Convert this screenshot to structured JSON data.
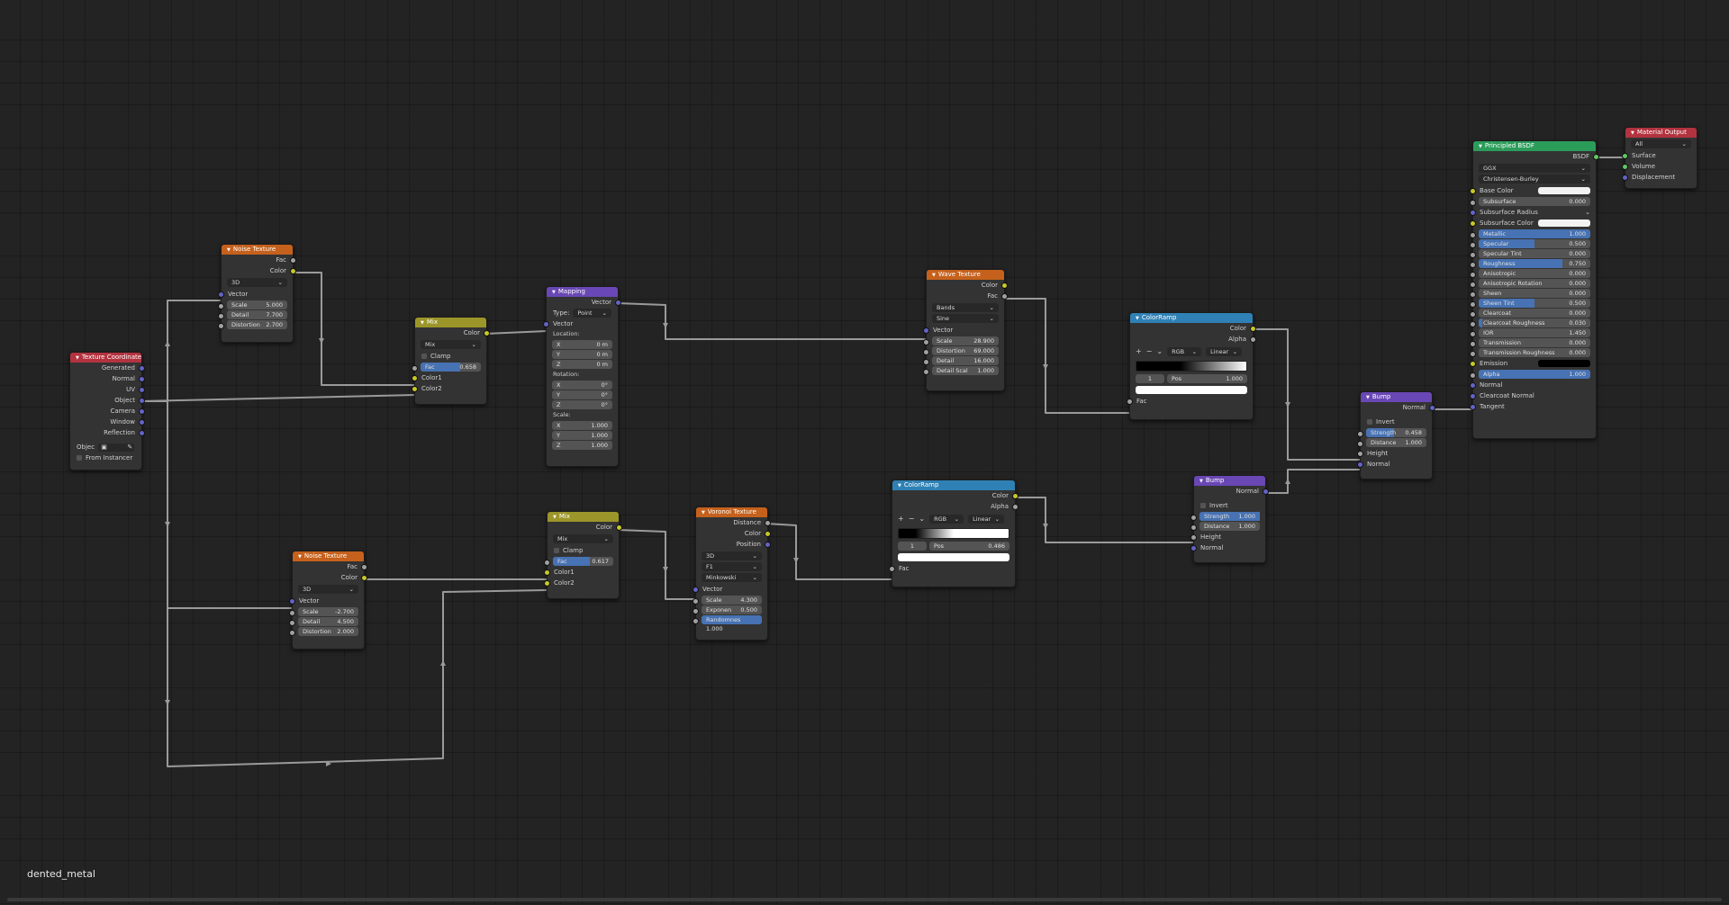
{
  "editor": {
    "frame_label": "dented_metal"
  },
  "texcoord": {
    "title": "Texture Coordinate",
    "outputs": [
      "Generated",
      "Normal",
      "UV",
      "Object",
      "Camera",
      "Window",
      "Reflection"
    ],
    "object_label": "Objec",
    "from_instancer": "From Instancer"
  },
  "noise1": {
    "title": "Noise Texture",
    "out_fac": "Fac",
    "out_color": "Color",
    "dim": "3D",
    "vector": "Vector",
    "fields": [
      {
        "label": "Scale",
        "value": "5.000"
      },
      {
        "label": "Detail",
        "value": "7.700"
      },
      {
        "label": "Distortion",
        "value": "2.700"
      }
    ]
  },
  "noise2": {
    "title": "Noise Texture",
    "out_fac": "Fac",
    "out_color": "Color",
    "dim": "3D",
    "vector": "Vector",
    "fields": [
      {
        "label": "Scale",
        "value": "-2.700"
      },
      {
        "label": "Detail",
        "value": "4.500"
      },
      {
        "label": "Distortion",
        "value": "2.000"
      }
    ]
  },
  "mix1": {
    "title": "Mix",
    "out": "Color",
    "mode": "Mix",
    "clamp": "Clamp",
    "fac_label": "Fac",
    "fac": "0.658",
    "fac_value": 0.658,
    "color1": "Color1",
    "color2": "Color2"
  },
  "mix2": {
    "title": "Mix",
    "out": "Color",
    "mode": "Mix",
    "clamp": "Clamp",
    "fac_label": "Fac",
    "fac": "0.617",
    "fac_value": 0.617,
    "color1": "Color1",
    "color2": "Color2"
  },
  "mapping": {
    "title": "Mapping",
    "out": "Vector",
    "type_label": "Type:",
    "type": "Point",
    "vector": "Vector",
    "location_label": "Location:",
    "location": [
      {
        "a": "X",
        "v": "0 m"
      },
      {
        "a": "Y",
        "v": "0 m"
      },
      {
        "a": "Z",
        "v": "0 m"
      }
    ],
    "rotation_label": "Rotation:",
    "rotation": [
      {
        "a": "X",
        "v": "0°"
      },
      {
        "a": "Y",
        "v": "0°"
      },
      {
        "a": "Z",
        "v": "0°"
      }
    ],
    "scale_label": "Scale:",
    "scale": [
      {
        "a": "X",
        "v": "1.000"
      },
      {
        "a": "Y",
        "v": "1.000"
      },
      {
        "a": "Z",
        "v": "1.000"
      }
    ]
  },
  "voronoi": {
    "title": "Voronoi Texture",
    "outputs": [
      "Distance",
      "Color",
      "Position"
    ],
    "dim": "3D",
    "feature": "F1",
    "metric": "Minkowski",
    "vector": "Vector",
    "fields": [
      {
        "label": "Scale",
        "value": "4.300"
      },
      {
        "label": "Exponen",
        "value": "0.500"
      }
    ],
    "randomness": "Randomnes 1.000",
    "randomness_value": 1.0
  },
  "wave": {
    "title": "Wave Texture",
    "out_color": "Color",
    "out_fac": "Fac",
    "type": "Bands",
    "profile": "Sine",
    "vector": "Vector",
    "fields": [
      {
        "label": "Scale",
        "value": "28.900"
      },
      {
        "label": "Distortion",
        "value": "69.000"
      },
      {
        "label": "Detail",
        "value": "16.000"
      },
      {
        "label": "Detail Scal",
        "value": "1.000"
      }
    ]
  },
  "ramp1": {
    "title": "ColorRamp",
    "out_color": "Color",
    "out_alpha": "Alpha",
    "mode": "RGB",
    "interp": "Linear",
    "index": "1",
    "pos_label": "Pos",
    "pos": "1.000",
    "fac": "Fac"
  },
  "ramp2": {
    "title": "ColorRamp",
    "out_color": "Color",
    "out_alpha": "Alpha",
    "mode": "RGB",
    "interp": "Linear",
    "index": "1",
    "pos_label": "Pos",
    "pos": "0.486",
    "fac": "Fac"
  },
  "bump1": {
    "title": "Bump",
    "out": "Normal",
    "invert": "Invert",
    "strength_label": "Strength",
    "strength": "0.458",
    "strength_value": 0.458,
    "distance_label": "Distance",
    "distance": "1.000",
    "height": "Height",
    "normal": "Normal"
  },
  "bump2": {
    "title": "Bump",
    "out": "Normal",
    "invert": "Invert",
    "strength_label": "Strength",
    "strength": "1.000",
    "strength_value": 1.0,
    "distance_label": "Distance",
    "distance": "1.000",
    "height": "Height",
    "normal": "Normal"
  },
  "bsdf": {
    "title": "Principled BSDF",
    "out": "BSDF",
    "distribution": "GGX",
    "subsurface_method": "Christensen-Burley",
    "base_color": "Base Color",
    "subsurface_color": "Subsurface Color",
    "subsurface_radius": "Subsurface Radius",
    "rows": [
      {
        "label": "Subsurface",
        "value": "0.000",
        "fill": 0
      },
      {
        "label": "Metallic",
        "value": "1.000",
        "fill": 1
      },
      {
        "label": "Specular",
        "value": "0.500",
        "fill": 0.5
      },
      {
        "label": "Specular Tint",
        "value": "0.000",
        "fill": 0
      },
      {
        "label": "Roughness",
        "value": "0.750",
        "fill": 0.75
      },
      {
        "label": "Anisotropic",
        "value": "0.000",
        "fill": 0
      },
      {
        "label": "Anisotropic Rotation",
        "value": "0.000",
        "fill": 0
      },
      {
        "label": "Sheen",
        "value": "0.000",
        "fill": 0
      },
      {
        "label": "Sheen Tint",
        "value": "0.500",
        "fill": 0.5
      },
      {
        "label": "Clearcoat",
        "value": "0.000",
        "fill": 0
      },
      {
        "label": "Clearcoat Roughness",
        "value": "0.030",
        "fill": 0.03
      },
      {
        "label": "IOR",
        "value": "1.450",
        "fill": 0
      },
      {
        "label": "Transmission",
        "value": "0.000",
        "fill": 0
      },
      {
        "label": "Transmission Roughness",
        "value": "0.000",
        "fill": 0
      }
    ],
    "emission": "Emission",
    "alpha_label": "Alpha",
    "alpha": "1.000",
    "normal": "Normal",
    "clearcoat_normal": "Clearcoat Normal",
    "tangent": "Tangent"
  },
  "output": {
    "title": "Material Output",
    "target": "All",
    "inputs": [
      "Surface",
      "Volume",
      "Displacement"
    ]
  },
  "colors": {
    "texture_header": "#c5611c",
    "input_header": "#b2333f",
    "color_header": "#9c9529",
    "vector_header": "#6947b4",
    "converter_header": "#2f81b5",
    "shader_header": "#2c9c5b",
    "wire": "#9a9a9a"
  }
}
